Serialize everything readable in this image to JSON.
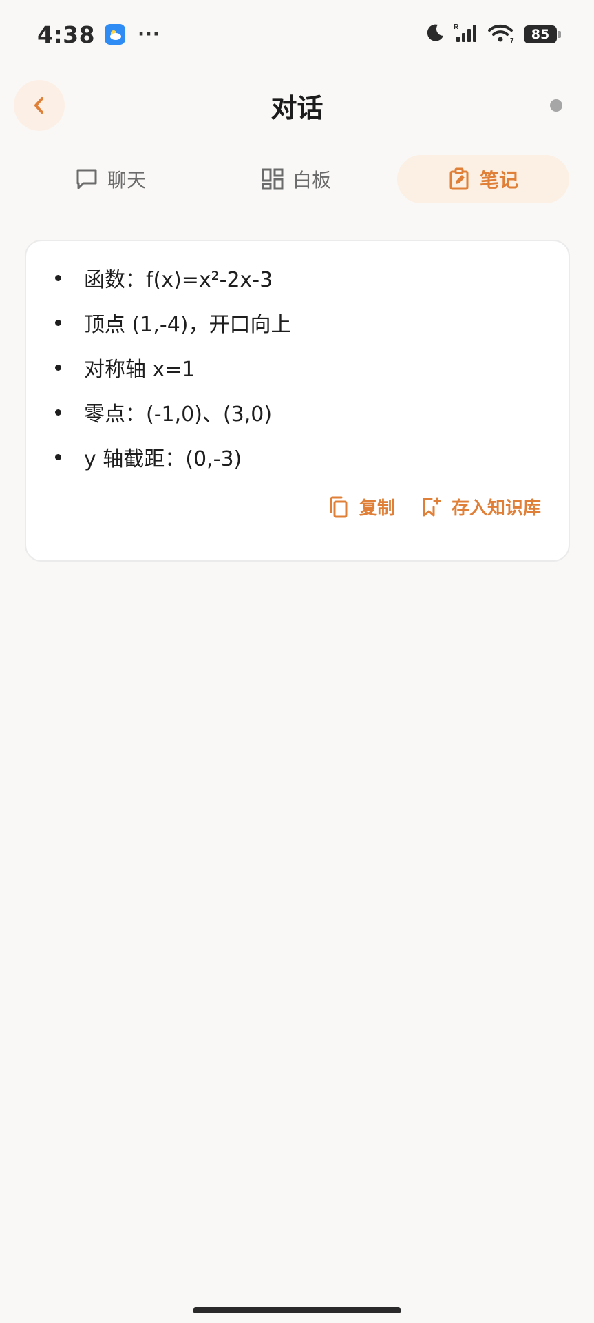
{
  "status_bar": {
    "time": "4:38",
    "more": "···",
    "signal_tag": "R",
    "wifi_tag": "7",
    "battery": "85"
  },
  "header": {
    "title": "对话"
  },
  "tabs": [
    {
      "label": "聊天",
      "icon": "chat-bubble-icon",
      "active": false
    },
    {
      "label": "白板",
      "icon": "board-grid-icon",
      "active": false
    },
    {
      "label": "笔记",
      "icon": "note-edit-icon",
      "active": true
    }
  ],
  "note": {
    "items": [
      "函数：f(x)=x²-2x-3",
      "顶点 (1,-4)，开口向上",
      "对称轴 x=1",
      "零点：(-1,0)、(3,0)",
      "y 轴截距：(0,-3)"
    ],
    "actions": {
      "copy": "复制",
      "save": "存入知识库"
    }
  },
  "colors": {
    "accent": "#e08038",
    "accent_bg": "#fcefe3",
    "page_bg": "#f9f8f6"
  }
}
